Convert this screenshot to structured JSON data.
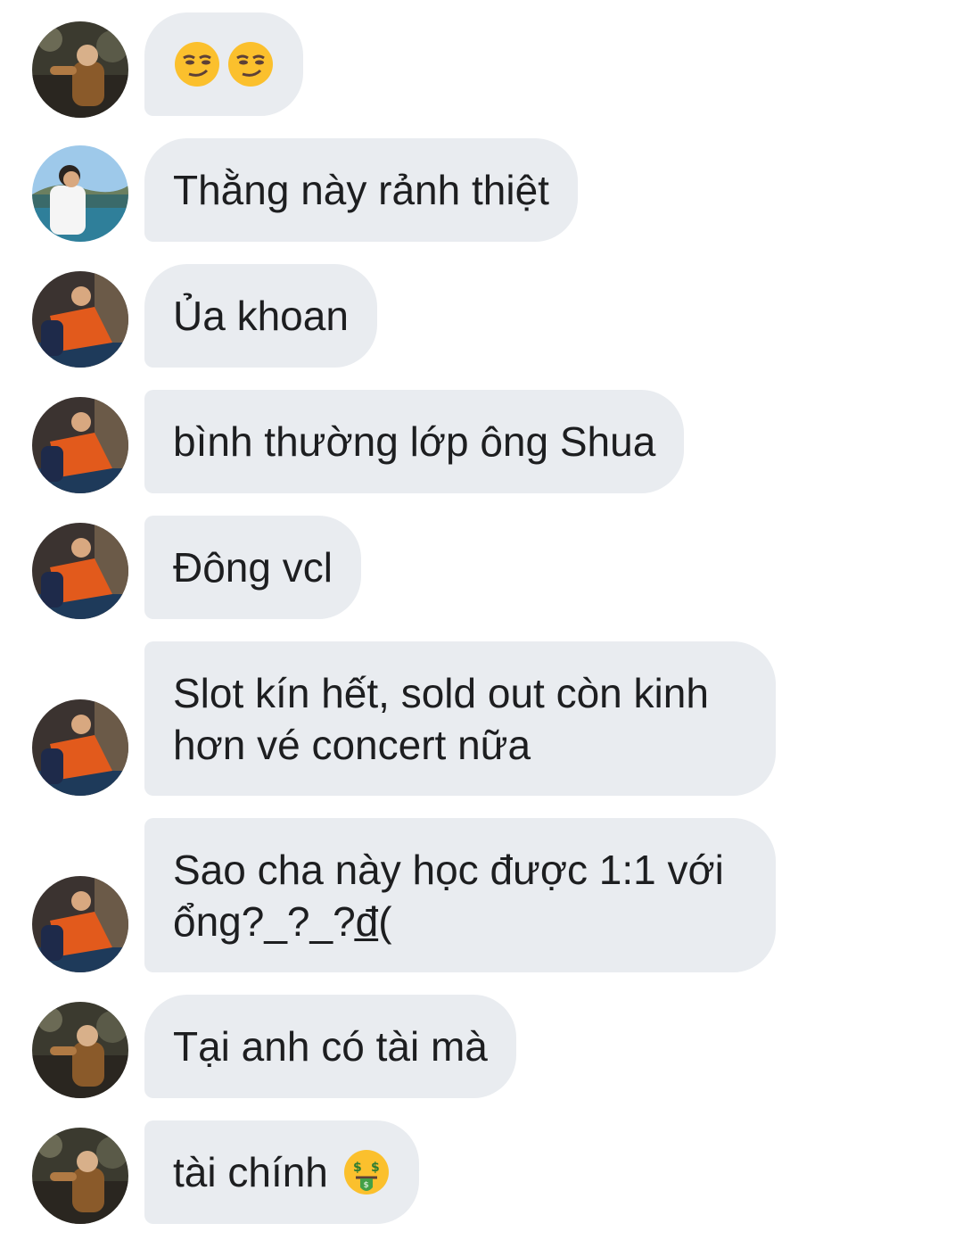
{
  "messages": [
    {
      "sender": "a",
      "text": "",
      "emojis": [
        "smirk-emoji",
        "smirk-emoji"
      ]
    },
    {
      "sender": "b",
      "text": "Thằng này rảnh thiệt"
    },
    {
      "sender": "c",
      "text": "Ủa khoan"
    },
    {
      "sender": "c",
      "text": "bình thường lớp ông Shua"
    },
    {
      "sender": "c",
      "text": "Đông vcl"
    },
    {
      "sender": "c",
      "text": "Slot kín hết, sold out còn kinh\nhơn vé concert nữa"
    },
    {
      "sender": "c",
      "text": "Sao cha này học được 1:1 với\nổng?_?_?đ̲("
    },
    {
      "sender": "a",
      "text": "Tại anh có tài mà"
    },
    {
      "sender": "a",
      "text": "tài chính",
      "emojis": [
        "money-mouth-emoji"
      ]
    }
  ],
  "colors": {
    "bubble": "#e9ecf0",
    "text": "#1d1e20",
    "emoji_yellow": "#fbc02d"
  }
}
